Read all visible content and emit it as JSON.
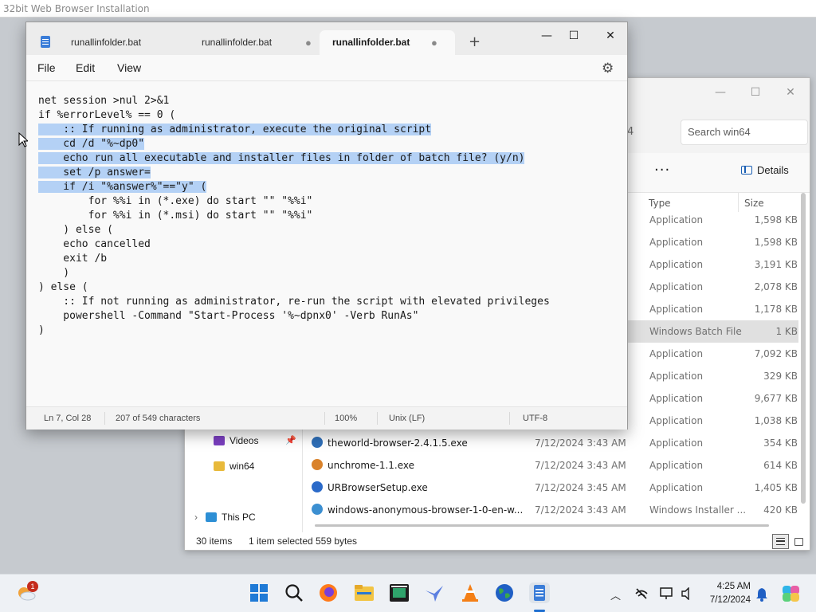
{
  "vm_title": "32bit Web Browser Installation",
  "notepad": {
    "tabs": [
      {
        "label": "runallinfolder.bat",
        "modified": false,
        "active": false
      },
      {
        "label": "runallinfolder.bat",
        "modified": true,
        "active": false
      },
      {
        "label": "runallinfolder.bat",
        "modified": true,
        "active": true
      }
    ],
    "new_tab": "+",
    "window_controls": {
      "minimize": "—",
      "maximize": "☐",
      "close": "✕"
    },
    "menu": {
      "file": "File",
      "edit": "Edit",
      "view": "View"
    },
    "code_lines": [
      "net session >nul 2>&1",
      "if %errorLevel% == 0 (",
      "    :: If running as administrator, execute the original script",
      "    cd /d \"%~dp0\"",
      "    echo run all executable and installer files in folder of batch file? (y/n)",
      "    set /p answer=",
      "    if /i \"%answer%\"==\"y\" (",
      "        for %%i in (*.exe) do start \"\" \"%%i\"",
      "        for %%i in (*.msi) do start \"\" \"%%i\"",
      "    ) else (",
      "    echo cancelled",
      "    exit /b",
      "    )",
      ") else (",
      "    :: If not running as administrator, re-run the script with elevated privileges",
      "    powershell -Command \"Start-Process '%~dpnx0' -Verb RunAs\"",
      ")"
    ],
    "highlighted_lines": [
      2,
      3,
      4,
      5,
      6
    ],
    "status": {
      "position": "Ln 7, Col 28",
      "chars": "207 of 549 characters",
      "zoom": "100%",
      "line_ending": "Unix (LF)",
      "encoding": "UTF-8"
    }
  },
  "explorer": {
    "search_placeholder": "Search win64",
    "address_fragment": "4",
    "more": "···",
    "details": "Details",
    "columns": {
      "type": "Type",
      "size": "Size"
    },
    "rows": [
      {
        "name": "",
        "date": "",
        "type": "Application",
        "size": "1,598 KB",
        "selected": false,
        "color": ""
      },
      {
        "name": "",
        "date": "",
        "type": "Application",
        "size": "1,598 KB",
        "selected": false,
        "color": ""
      },
      {
        "name": "",
        "date": "",
        "type": "Application",
        "size": "3,191 KB",
        "selected": false,
        "color": ""
      },
      {
        "name": "",
        "date": "",
        "type": "Application",
        "size": "2,078 KB",
        "selected": false,
        "color": ""
      },
      {
        "name": "",
        "date": "",
        "type": "Application",
        "size": "1,178 KB",
        "selected": false,
        "color": ""
      },
      {
        "name": "",
        "date": "",
        "type": "Windows Batch File",
        "size": "1 KB",
        "selected": true,
        "color": ""
      },
      {
        "name": "",
        "date": "",
        "type": "Application",
        "size": "7,092 KB",
        "selected": false,
        "color": ""
      },
      {
        "name": "",
        "date": "",
        "type": "Application",
        "size": "329 KB",
        "selected": false,
        "color": ""
      },
      {
        "name": "",
        "date": "",
        "type": "Application",
        "size": "9,677 KB",
        "selected": false,
        "color": ""
      },
      {
        "name": "",
        "date": "",
        "type": "Application",
        "size": "1,038 KB",
        "selected": false,
        "color": ""
      },
      {
        "name": "theworld-browser-2.4.1.5.exe",
        "date": "7/12/2024 3:43 AM",
        "type": "Application",
        "size": "354 KB",
        "selected": false,
        "color": "#2f6fb8"
      },
      {
        "name": "unchrome-1.1.exe",
        "date": "7/12/2024 3:43 AM",
        "type": "Application",
        "size": "614 KB",
        "selected": false,
        "color": "#d9822b"
      },
      {
        "name": "URBrowserSetup.exe",
        "date": "7/12/2024 3:45 AM",
        "type": "Application",
        "size": "1,405 KB",
        "selected": false,
        "color": "#2b6ac9"
      },
      {
        "name": "windows-anonymous-browser-1-0-en-w...",
        "date": "7/12/2024 3:43 AM",
        "type": "Windows Installer ...",
        "size": "420 KB",
        "selected": false,
        "color": "#3c8fd1"
      }
    ],
    "nav": [
      {
        "label": "Videos",
        "pinned": true,
        "color": "#7a3fbf"
      },
      {
        "label": "win64",
        "pinned": false,
        "color": "#e8b93a"
      },
      {
        "label": "This PC",
        "pinned": false,
        "color": "#2d8fd5"
      }
    ],
    "status": {
      "count": "30 items",
      "selection": "1 item selected",
      "bytes": "559 bytes"
    }
  },
  "taskbar": {
    "weather_badge": "1",
    "time": "4:25 AM",
    "date": "7/12/2024",
    "apps": [
      "windows-start-icon",
      "search-icon",
      "firefox-icon",
      "file-explorer-icon",
      "media-app-icon",
      "bird-app-icon",
      "vlc-icon",
      "globe-browser-icon",
      "notepad-icon"
    ]
  }
}
